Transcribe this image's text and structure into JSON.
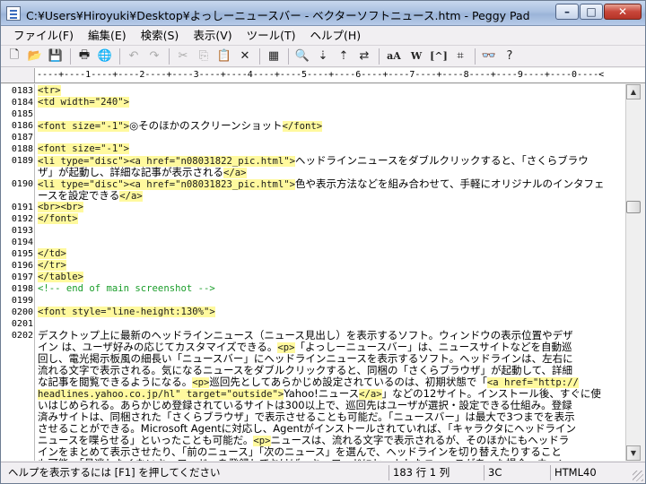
{
  "window": {
    "title": "C:¥Users¥Hiroyuki¥Desktop¥よっしーニュースバー - ベクターソフトニュース.htm - Peggy Pad",
    "minimize_glyph": "–",
    "maximize_glyph": "□",
    "close_glyph": "✕"
  },
  "menu": [
    "ファイル(F)",
    "編集(E)",
    "検索(S)",
    "表示(V)",
    "ツール(T)",
    "ヘルプ(H)"
  ],
  "toolbar": {
    "icons": [
      "new-file-icon",
      "open-folder-icon",
      "save-icon",
      "print-icon",
      "browser-preview-icon",
      "undo-icon",
      "redo-icon",
      "cut-icon",
      "copy-icon",
      "paste-icon",
      "delete-icon",
      "select-all-icon",
      "find-icon",
      "find-next-icon",
      "find-prev-icon",
      "replace-icon",
      "font-size-icon",
      "word-icon",
      "bracket-icon",
      "tag-icon",
      "binoculars-icon",
      "help-icon"
    ],
    "text_buttons": {
      "case": "aA",
      "word": "W",
      "bracket": "[^]"
    }
  },
  "ruler": "----+----1----+----2----+----3----+----4----+----5----+----6----+----7----+----8----+----9----+----0----<",
  "lines": [
    {
      "n": "0183",
      "segs": [
        [
          "tag",
          "<tr>"
        ]
      ]
    },
    {
      "n": "0184",
      "segs": [
        [
          "tag",
          "<td width=\"240\">"
        ]
      ]
    },
    {
      "n": "0185",
      "segs": []
    },
    {
      "n": "0186",
      "segs": [
        [
          "tag",
          "<font size=\"-1\">"
        ],
        [
          "jp",
          "◎そのほかのスクリーンショット"
        ],
        [
          "tag",
          "</font>"
        ]
      ]
    },
    {
      "n": "0187",
      "segs": []
    },
    {
      "n": "0188",
      "segs": [
        [
          "tag",
          "<font size=\"-1\">"
        ]
      ]
    },
    {
      "n": "0189",
      "segs": [
        [
          "tag",
          "<li type=\"disc\">"
        ],
        [
          "tag",
          "<a href=\"n08031822_pic.html\">"
        ],
        [
          "jp",
          "ヘッドラインニュースをダブルクリックすると、「さくらブラウ"
        ]
      ]
    },
    {
      "n": "",
      "segs": [
        [
          "jp",
          "ザ」が起動し、詳細な記事が表示される"
        ],
        [
          "tag",
          "</a>"
        ]
      ]
    },
    {
      "n": "0190",
      "segs": [
        [
          "tag",
          "<li type=\"disc\">"
        ],
        [
          "tag",
          "<a href=\"n08031823_pic.html\">"
        ],
        [
          "jp",
          "色や表示方法などを組み合わせて、手軽にオリジナルのインタフェ"
        ]
      ]
    },
    {
      "n": "",
      "segs": [
        [
          "jp",
          "ースを設定できる"
        ],
        [
          "tag",
          "</a>"
        ]
      ]
    },
    {
      "n": "0191",
      "segs": [
        [
          "tag",
          "<br>"
        ],
        [
          "tag",
          "<br>"
        ]
      ]
    },
    {
      "n": "0192",
      "segs": [
        [
          "tag",
          "</font>"
        ]
      ]
    },
    {
      "n": "0193",
      "segs": []
    },
    {
      "n": "0194",
      "segs": []
    },
    {
      "n": "0195",
      "segs": [
        [
          "tag",
          "</td>"
        ]
      ]
    },
    {
      "n": "0196",
      "segs": [
        [
          "tag",
          "</tr>"
        ]
      ]
    },
    {
      "n": "0197",
      "segs": [
        [
          "tag",
          "</table>"
        ]
      ]
    },
    {
      "n": "0198",
      "segs": [
        [
          "cmt",
          "<!-- end of main screenshot -->"
        ]
      ]
    },
    {
      "n": "0199",
      "segs": []
    },
    {
      "n": "0200",
      "segs": [
        [
          "tag",
          "<font style=\"line-height:130%\">"
        ]
      ]
    },
    {
      "n": "0201",
      "segs": []
    },
    {
      "n": "0202",
      "segs": [
        [
          "jp",
          "デスクトップ上に最新のヘッドラインニュース（ニュース見出し）を表示するソフト。ウィンドウの表示位置やデザ"
        ]
      ]
    },
    {
      "n": "",
      "segs": [
        [
          "jp",
          "イン は、ユーザ好みの応じてカスタマイズできる。"
        ],
        [
          "tag",
          "<p>"
        ],
        [
          "jp",
          "「よっしーニュースバー」は、ニュースサイトなどを自動巡"
        ]
      ]
    },
    {
      "n": "",
      "segs": [
        [
          "jp",
          "回し、電光掲示板風の細長い「ニュースバー」にヘッドラインニュースを表示するソフト。ヘッドラインは、左右に"
        ]
      ]
    },
    {
      "n": "",
      "segs": [
        [
          "jp",
          "流れる文字で表示される。気になるニュースをダブルクリックすると、同梱の「さくらブラウザ」が起動して、詳細"
        ]
      ]
    },
    {
      "n": "",
      "segs": [
        [
          "jp",
          "な記事を閲覧できるようになる。"
        ],
        [
          "tag",
          "<p>"
        ],
        [
          "jp",
          "巡回先としてあらかじめ設定されているのは、初期状態で「"
        ],
        [
          "tag",
          "<a href=\"http://"
        ]
      ]
    },
    {
      "n": "",
      "segs": [
        [
          "tag",
          "headlines.yahoo.co.jp/hl\" target=\"outside\">"
        ],
        [
          "jp",
          "Yahoo!ニュース"
        ],
        [
          "tag",
          "</a>"
        ],
        [
          "jp",
          "」などの12サイト。インストール後、すぐに使"
        ]
      ]
    },
    {
      "n": "",
      "segs": [
        [
          "jp",
          "いはじめられる。あらかじめ登録されているサイトは300以上で、巡回先はユーザが選択・設定できる仕組み。登録"
        ]
      ]
    },
    {
      "n": "",
      "segs": [
        [
          "jp",
          "済みサイトは、同梱された「さくらブラウザ」で表示させることも可能だ。「ニュースバー」は最大で3つまでを表示"
        ]
      ]
    },
    {
      "n": "",
      "segs": [
        [
          "jp",
          "させることができる。Microsoft Agentに対応し、Agentがインストールされていれば、「キャラクタにヘッドライン"
        ]
      ]
    },
    {
      "n": "",
      "segs": [
        [
          "jp",
          "ニュースを喋らせる」といったことも可能だ。"
        ],
        [
          "tag",
          "<p>"
        ],
        [
          "jp",
          "ニュースは、流れる文字で表示されるが、そのほかにもヘッドラ"
        ]
      ]
    },
    {
      "n": "",
      "segs": [
        [
          "jp",
          "インをまとめて表示させたり、「前のニュース」「次のニュース」を選んで、ヘッドラインを切り替えたりすること"
        ]
      ]
    },
    {
      "n": "",
      "segs": [
        [
          "jp",
          "も可能。「見逃したくないキーワード」を登録しておけば、キーワードにヒットしたニュースがあった場合、ウィン"
        ]
      ]
    }
  ],
  "status": {
    "help": "ヘルプを表示するには [F1] を押してください",
    "position": "183 行 1 列",
    "encoding": "3C",
    "mode": "HTML40"
  }
}
